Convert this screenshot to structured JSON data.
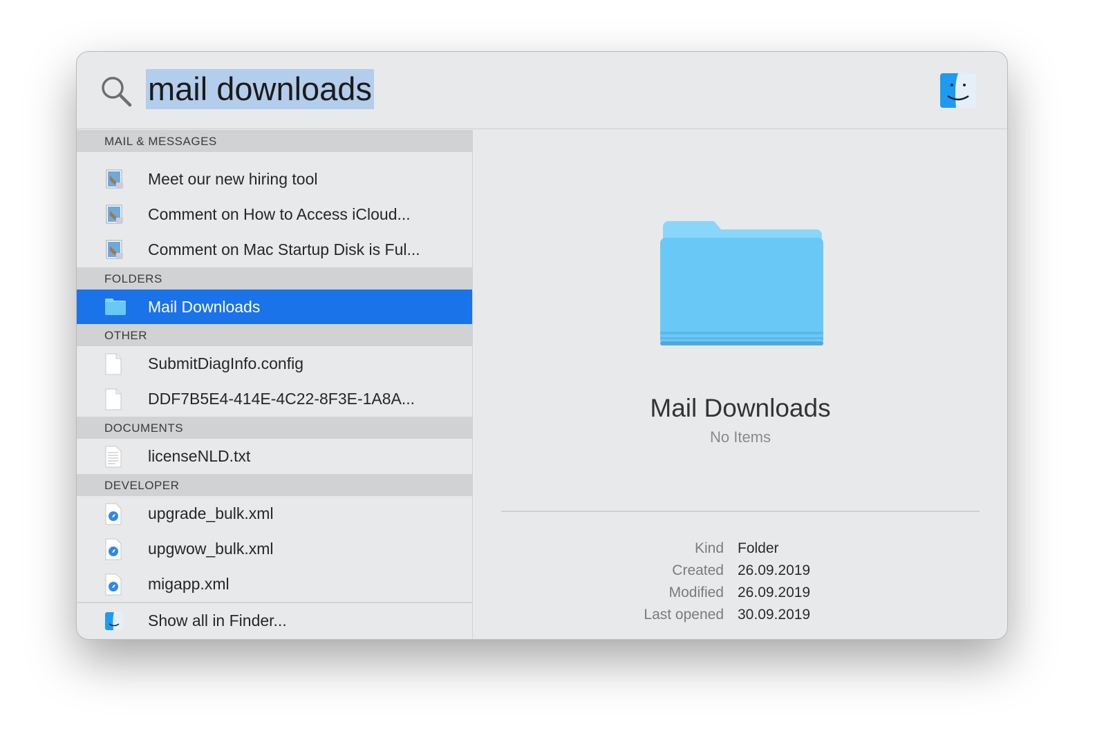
{
  "search": {
    "query": "mail downloads",
    "icon": "magnifying-glass-icon",
    "app_icon": "finder-icon"
  },
  "sections": [
    {
      "title": "MAIL & MESSAGES",
      "items": [
        {
          "label": "Meet our new hiring tool",
          "icon": "mail-icon"
        },
        {
          "label": "Comment on How to Access iCloud...",
          "icon": "mail-icon"
        },
        {
          "label": "Comment on Mac Startup Disk is Ful...",
          "icon": "mail-icon"
        }
      ]
    },
    {
      "title": "FOLDERS",
      "items": [
        {
          "label": "Mail Downloads",
          "icon": "folder-icon",
          "selected": true
        }
      ]
    },
    {
      "title": "OTHER",
      "items": [
        {
          "label": "SubmitDiagInfo.config",
          "icon": "blank-document-icon"
        },
        {
          "label": "DDF7B5E4-414E-4C22-8F3E-1A8A...",
          "icon": "blank-document-icon"
        }
      ]
    },
    {
      "title": "DOCUMENTS",
      "items": [
        {
          "label": "licenseNLD.txt",
          "icon": "text-document-icon"
        }
      ]
    },
    {
      "title": "DEVELOPER",
      "items": [
        {
          "label": "upgrade_bulk.xml",
          "icon": "safari-document-icon"
        },
        {
          "label": "upgwow_bulk.xml",
          "icon": "safari-document-icon"
        },
        {
          "label": "migapp.xml",
          "icon": "safari-document-icon"
        }
      ]
    }
  ],
  "show_all": "Show all in Finder...",
  "preview": {
    "title": "Mail Downloads",
    "subtitle": "No Items",
    "meta": [
      {
        "k": "Kind",
        "v": "Folder"
      },
      {
        "k": "Created",
        "v": "26.09.2019"
      },
      {
        "k": "Modified",
        "v": "26.09.2019"
      },
      {
        "k": "Last opened",
        "v": "30.09.2019"
      }
    ]
  },
  "colors": {
    "selection": "#1a73e8",
    "query_highlight": "#b3cdec",
    "folder": "#6ac8f7"
  }
}
